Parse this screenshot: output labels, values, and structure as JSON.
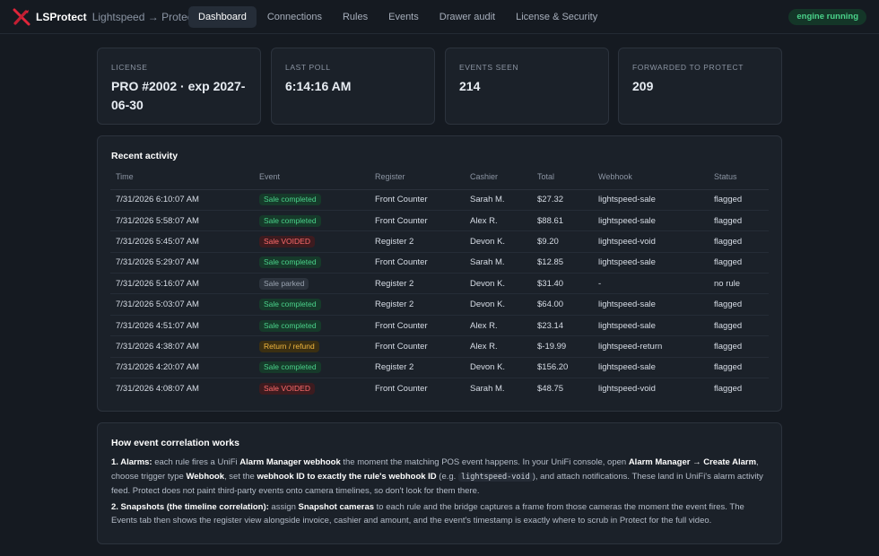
{
  "brand": {
    "name": "LSProtect",
    "tagline": "Lightspeed → Protect",
    "logo_icon": "lsprotect-logo-icon"
  },
  "nav": {
    "tabs": [
      {
        "label": "Dashboard",
        "active": true
      },
      {
        "label": "Connections",
        "active": false
      },
      {
        "label": "Rules",
        "active": false
      },
      {
        "label": "Events",
        "active": false
      },
      {
        "label": "Drawer audit",
        "active": false
      },
      {
        "label": "License & Security",
        "active": false
      }
    ],
    "status_badge": "engine running"
  },
  "stats": [
    {
      "label": "License",
      "value": "PRO #2002 · exp 2027-06-30"
    },
    {
      "label": "Last poll",
      "value": "6:14:16 AM"
    },
    {
      "label": "Events seen",
      "value": "214"
    },
    {
      "label": "Forwarded to Protect",
      "value": "209"
    }
  ],
  "activity": {
    "title": "Recent activity",
    "columns": [
      "Time",
      "Event",
      "Register",
      "Cashier",
      "Total",
      "Webhook",
      "Status"
    ],
    "rows": [
      {
        "time": "7/31/2026 6:10:07 AM",
        "event": "Sale completed",
        "event_kind": "green",
        "register": "Front Counter",
        "cashier": "Sarah M.",
        "total": "$27.32",
        "webhook": "lightspeed-sale",
        "status": "flagged"
      },
      {
        "time": "7/31/2026 5:58:07 AM",
        "event": "Sale completed",
        "event_kind": "green",
        "register": "Front Counter",
        "cashier": "Alex R.",
        "total": "$88.61",
        "webhook": "lightspeed-sale",
        "status": "flagged"
      },
      {
        "time": "7/31/2026 5:45:07 AM",
        "event": "Sale VOIDED",
        "event_kind": "red",
        "register": "Register 2",
        "cashier": "Devon K.",
        "total": "$9.20",
        "webhook": "lightspeed-void",
        "status": "flagged"
      },
      {
        "time": "7/31/2026 5:29:07 AM",
        "event": "Sale completed",
        "event_kind": "green",
        "register": "Front Counter",
        "cashier": "Sarah M.",
        "total": "$12.85",
        "webhook": "lightspeed-sale",
        "status": "flagged"
      },
      {
        "time": "7/31/2026 5:16:07 AM",
        "event": "Sale parked",
        "event_kind": "gray",
        "register": "Register 2",
        "cashier": "Devon K.",
        "total": "$31.40",
        "webhook": "-",
        "status": "no rule"
      },
      {
        "time": "7/31/2026 5:03:07 AM",
        "event": "Sale completed",
        "event_kind": "green",
        "register": "Register 2",
        "cashier": "Devon K.",
        "total": "$64.00",
        "webhook": "lightspeed-sale",
        "status": "flagged"
      },
      {
        "time": "7/31/2026 4:51:07 AM",
        "event": "Sale completed",
        "event_kind": "green",
        "register": "Front Counter",
        "cashier": "Alex R.",
        "total": "$23.14",
        "webhook": "lightspeed-sale",
        "status": "flagged"
      },
      {
        "time": "7/31/2026 4:38:07 AM",
        "event": "Return / refund",
        "event_kind": "amber",
        "register": "Front Counter",
        "cashier": "Alex R.",
        "total": "$-19.99",
        "webhook": "lightspeed-return",
        "status": "flagged"
      },
      {
        "time": "7/31/2026 4:20:07 AM",
        "event": "Sale completed",
        "event_kind": "green",
        "register": "Register 2",
        "cashier": "Devon K.",
        "total": "$156.20",
        "webhook": "lightspeed-sale",
        "status": "flagged"
      },
      {
        "time": "7/31/2026 4:08:07 AM",
        "event": "Sale VOIDED",
        "event_kind": "red",
        "register": "Front Counter",
        "cashier": "Sarah M.",
        "total": "$48.75",
        "webhook": "lightspeed-void",
        "status": "flagged"
      }
    ]
  },
  "how": {
    "title": "How event correlation works",
    "p1": {
      "t1": "1. Alarms:",
      "t2": " each rule fires a UniFi ",
      "t3": "Alarm Manager webhook",
      "t4": " the moment the matching POS event happens. In your UniFi console, open ",
      "t5": "Alarm Manager → Create Alarm",
      "t6": ", choose trigger type ",
      "t7": "Webhook",
      "t8": ", set the ",
      "t9": "webhook ID to exactly the rule's webhook ID",
      "t10": " (e.g. ",
      "t11": "lightspeed-void",
      "t12": "), and attach notifications. These land in UniFi's alarm activity feed. Protect does not paint third-party events onto camera timelines, so don't look for them there."
    },
    "p2": {
      "t1": "2. Snapshots (the timeline correlation):",
      "t2": " assign ",
      "t3": "Snapshot cameras",
      "t4": " to each rule and the bridge captures a frame from those cameras the moment the event fires. The Events tab then shows the register view alongside invoice, cashier and amount, and the event's timestamp is exactly where to scrub in Protect for the full video."
    }
  },
  "colors": {
    "accent": "#4ad28a",
    "danger": "#ff6b6b",
    "warning": "#f2b73f",
    "logo": "#e0253a"
  }
}
